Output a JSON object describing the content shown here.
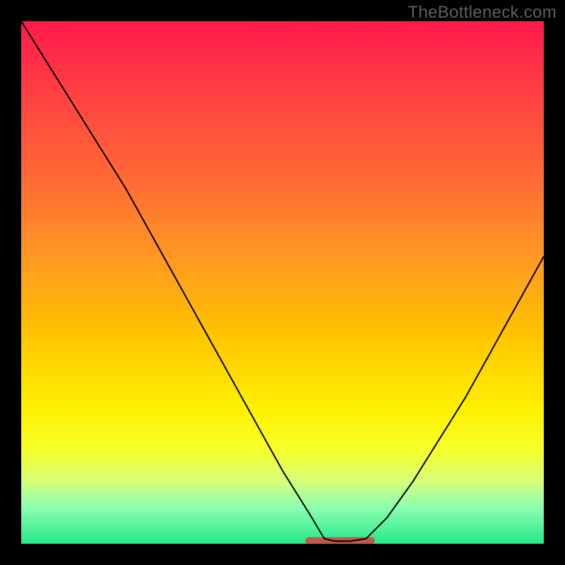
{
  "watermark": "TheBottleneck.com",
  "chart_data": {
    "type": "line",
    "title": "",
    "xlabel": "",
    "ylabel": "",
    "xlim": [
      0,
      100
    ],
    "ylim": [
      0,
      100
    ],
    "x": [
      0,
      5,
      10,
      15,
      20,
      25,
      30,
      35,
      40,
      45,
      50,
      55,
      58,
      60,
      63,
      66,
      70,
      75,
      80,
      85,
      90,
      95,
      100
    ],
    "values": [
      100,
      92,
      84,
      76,
      68,
      59,
      50,
      41,
      32,
      23,
      14,
      6,
      1,
      0.5,
      0.5,
      1,
      5,
      12,
      20,
      28,
      37,
      46,
      55
    ],
    "gradient_colors": {
      "top": "#ff1a4a",
      "mid_upper": "#ff9a20",
      "mid": "#fff000",
      "mid_lower": "#d8ff7a",
      "bottom": "#25e88a"
    },
    "flat_segment": {
      "x_start": 55,
      "x_end": 67,
      "stroke": "#c05a4e",
      "stroke_width_px": 10
    },
    "line_style": {
      "stroke": "#000000",
      "stroke_width_px": 2
    }
  }
}
